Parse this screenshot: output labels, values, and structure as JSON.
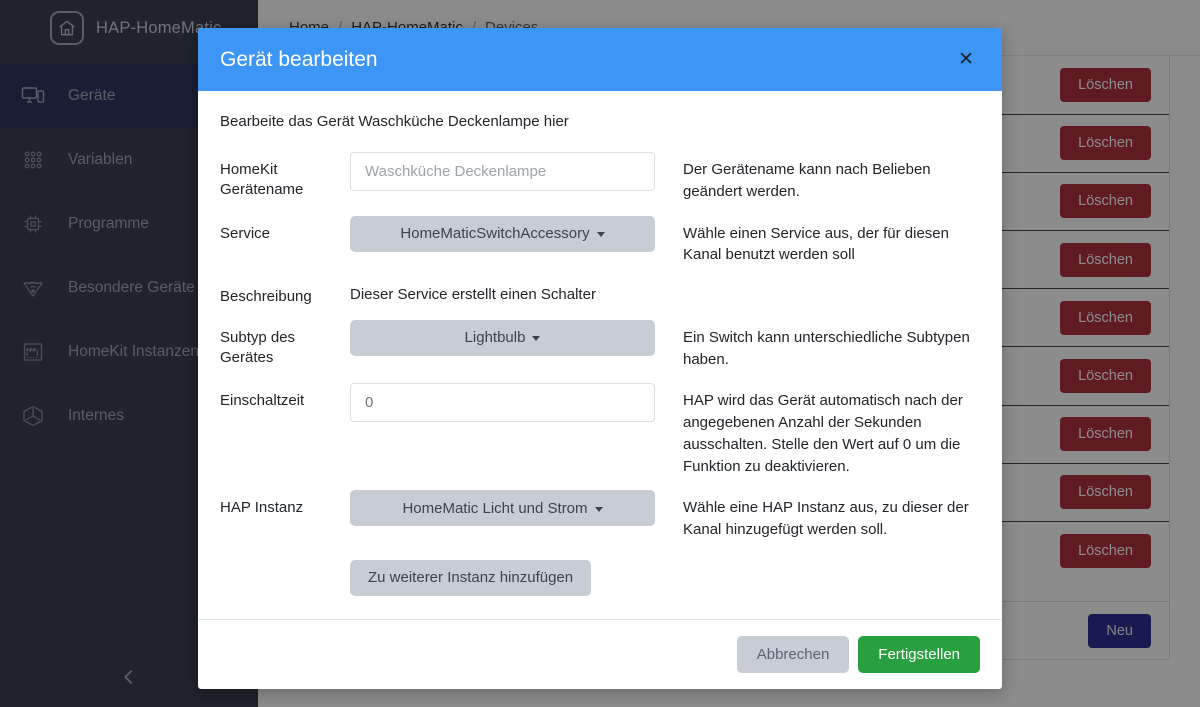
{
  "sidebar": {
    "brand": {
      "label": "HAP-HomeMatic",
      "logo_icon": "home-shield-icon"
    },
    "items": [
      {
        "label": "Geräte",
        "icon": "devices-icon",
        "active": true
      },
      {
        "label": "Variablen",
        "icon": "dots-grid-icon",
        "active": false
      },
      {
        "label": "Programme",
        "icon": "chip-icon",
        "active": false
      },
      {
        "label": "Besondere Geräte",
        "icon": "signal-cone-icon",
        "active": false
      },
      {
        "label": "HomeKit Instanzen",
        "icon": "factory-icon",
        "active": false
      },
      {
        "label": "Internes",
        "icon": "mercedes-icon",
        "active": false
      }
    ],
    "collapse_icon": "chevron-left-icon",
    "bg_color": "#262b3f",
    "active_color": "#1d2150"
  },
  "breadcrumb": {
    "items": [
      "Home",
      "HAP-HomeMatic",
      "Devices"
    ],
    "separator": "/"
  },
  "table": {
    "rows": [
      {
        "action_label": "Löschen"
      },
      {
        "action_label": "Löschen"
      },
      {
        "action_label": "Löschen"
      },
      {
        "action_label": "Löschen"
      },
      {
        "action_label": "Löschen"
      },
      {
        "action_label": "Löschen"
      },
      {
        "action_label": "Löschen"
      },
      {
        "action_label": "Löschen"
      },
      {
        "action_label": "Löschen"
      }
    ],
    "delete_color": "#a71d2a"
  },
  "panel_footer": {
    "new_label": "Neu",
    "new_color": "#1a1a8c"
  },
  "modal": {
    "title": "Gerät bearbeiten",
    "close_icon": "close-icon",
    "header_color": "#3d96f5",
    "intro": "Bearbeite das Gerät Waschküche Deckenlampe hier",
    "fields": [
      {
        "label": "HomeKit Gerätename",
        "type": "text",
        "value": "",
        "placeholder": "Waschküche Deckenlampe",
        "help": "Der Gerätename kann nach Belieben geändert werden."
      },
      {
        "label": "Service",
        "type": "select",
        "value": "HomeMaticSwitchAccessory",
        "help": "Wähle einen Service aus, der für diesen Kanal benutzt werden soll"
      },
      {
        "label": "Beschreibung",
        "type": "static",
        "value": "Dieser Service erstellt einen Schalter",
        "help": ""
      },
      {
        "label": "Subtyp des Gerätes",
        "type": "select",
        "value": "Lightbulb",
        "help": "Ein Switch kann unterschiedliche Subtypen haben."
      },
      {
        "label": "Einschaltzeit",
        "type": "text",
        "value": "0",
        "placeholder": "",
        "help": "HAP wird das Gerät automatisch nach der angegebenen Anzahl der Sekunden ausschalten. Stelle den Wert auf 0 um die Funktion zu deaktivieren."
      },
      {
        "label": "HAP Instanz",
        "type": "select",
        "value": "HomeMatic Licht und Strom",
        "help": "Wähle eine HAP Instanz aus, zu dieser der Kanal hinzugefügt werden soll."
      }
    ],
    "add_instance_label": "Zu weiterer Instanz hinzufügen",
    "cancel_label": "Abbrechen",
    "confirm_label": "Fertigstellen",
    "confirm_color": "#28a03f"
  }
}
